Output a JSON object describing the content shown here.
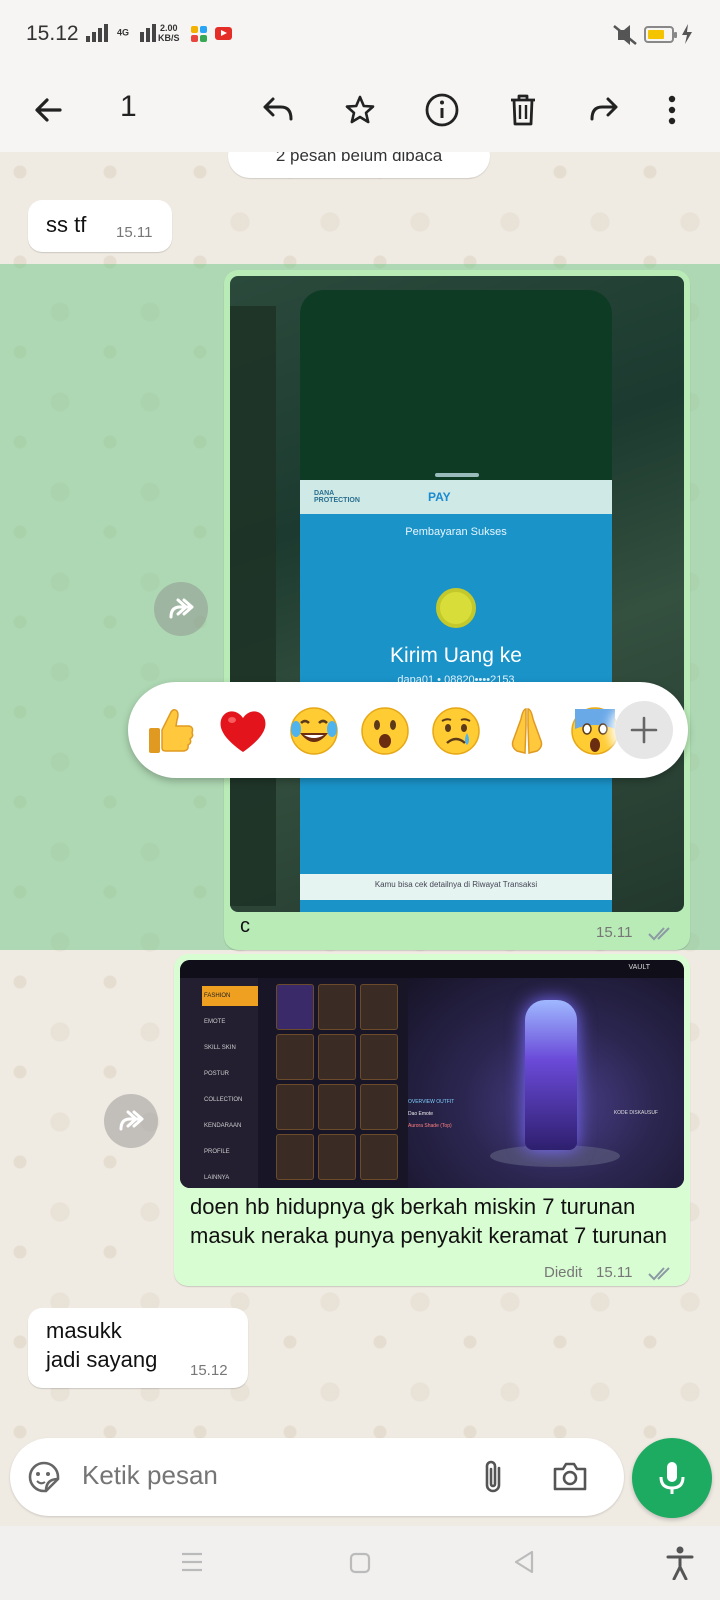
{
  "status_bar": {
    "time": "15.12",
    "network": "4G",
    "speed_value": "2.00",
    "speed_unit": "KB/S",
    "battery_level": 0.72
  },
  "action_bar": {
    "selected_count": "1"
  },
  "chat": {
    "unread_banner": "2 pesan belum dibaca",
    "messages": [
      {
        "dir": "in",
        "text": "ss tf",
        "time": "15.11"
      },
      {
        "dir": "out",
        "type": "image",
        "caption": "c",
        "time": "15.11",
        "status": "read"
      },
      {
        "dir": "out",
        "type": "image",
        "caption": "doen hb hidupnya gk berkah miskin 7 turunan masuk neraka punya penyakit keramat 7 turunan",
        "edited_label": "Diedit",
        "time": "15.11",
        "status": "read"
      },
      {
        "dir": "in",
        "text_line1": "masukk",
        "text_line2": "jadi sayang",
        "time": "15.12"
      }
    ]
  },
  "payment_screenshot": {
    "brand": "DANA PROTECTION",
    "pay_label": "PAY",
    "status": "Pembayaran Sukses",
    "headline": "Kirim Uang ke",
    "account": "dapa01 • 08820••••2153",
    "footer": "Kamu bisa cek detailnya di Riwayat Transaksi"
  },
  "game_screenshot": {
    "menu": [
      "FASHION",
      "EMOTE",
      "SKILL SKIN",
      "POSTUR",
      "COLLECTION",
      "KENDARAAN",
      "PROFILE",
      "LAINNYA"
    ],
    "vault_label": "VAULT",
    "outfit_label": "OVERVIEW OUTFIT",
    "item1": "Dao Emote",
    "item2": "Aurora Shade (Top)",
    "kode_label": "KODE DISKAUSUF",
    "colors": {
      "bg": "#181626",
      "glow": "#7b6bff"
    }
  },
  "reactions": [
    "👍",
    "❤️",
    "😂",
    "😮",
    "😢",
    "🙏",
    "😱"
  ],
  "input": {
    "placeholder": "Ketik pesan"
  },
  "colors": {
    "outgoing_bubble": "#d9fdd3",
    "selection": "#8fd1a1",
    "accent": "#1daa61",
    "read_ticks": "#8b9aa3"
  }
}
